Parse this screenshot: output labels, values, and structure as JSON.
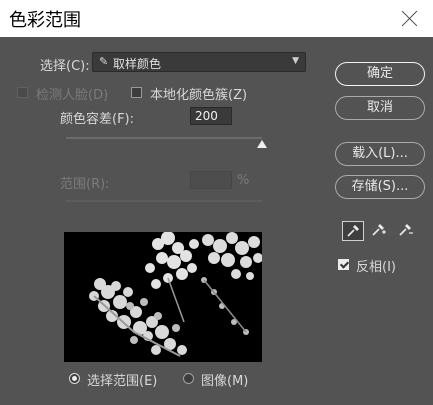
{
  "window": {
    "title": "色彩范围"
  },
  "select_row": {
    "label": "选择(C):",
    "value": "取样颜色"
  },
  "options": {
    "detect_faces": {
      "label": "检测人脸(D)",
      "checked": false,
      "enabled": false
    },
    "localized_clusters": {
      "label": "本地化颜色簇(Z)",
      "checked": false
    }
  },
  "fuzziness": {
    "label": "颜色容差(F):",
    "value": "200",
    "slider_fraction": 1.0
  },
  "range": {
    "label": "范围(R):",
    "value": "",
    "unit": "%",
    "enabled": false
  },
  "buttons": {
    "ok": "确定",
    "cancel": "取消",
    "load": "载入(L)...",
    "save": "存储(S)..."
  },
  "tools": [
    "eyedropper-icon",
    "eyedropper-plus-icon",
    "eyedropper-minus-icon"
  ],
  "invert": {
    "label": "反相(I)",
    "checked": true
  },
  "view": {
    "selection": {
      "label": "选择范围(E)",
      "selected": true
    },
    "image": {
      "label": "图像(M)",
      "selected": false
    }
  },
  "colors": {
    "panel": "#535353",
    "field": "#3a3a3a",
    "titlebar": "#ffffff"
  }
}
